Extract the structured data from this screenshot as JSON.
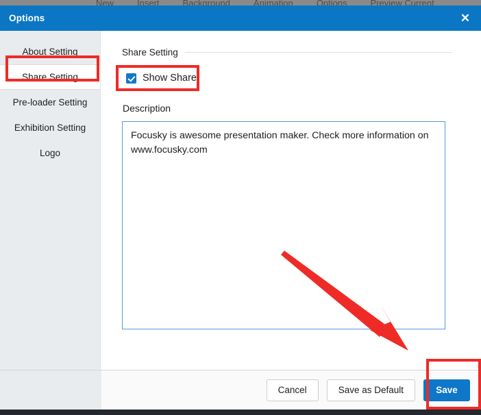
{
  "app": {
    "menu_items": [
      "New",
      "Insert",
      "Background",
      "Animation",
      "Options",
      "Preview Current"
    ]
  },
  "dialog": {
    "title": "Options",
    "close_label": "✕"
  },
  "sidebar": {
    "items": [
      {
        "label": "About Setting",
        "selected": false
      },
      {
        "label": "Share Setting",
        "selected": true
      },
      {
        "label": "Pre-loader Setting",
        "selected": false
      },
      {
        "label": "Exhibition Setting",
        "selected": false
      },
      {
        "label": "Logo",
        "selected": false
      }
    ]
  },
  "content": {
    "group_title": "Share Setting",
    "show_share": {
      "label": "Show Share",
      "checked": true
    },
    "description": {
      "label": "Description",
      "value": "Focusky is awesome presentation maker. Check more information on www.focusky.com"
    }
  },
  "footer": {
    "cancel_label": "Cancel",
    "save_as_default_label": "Save as Default",
    "save_label": "Save"
  },
  "colors": {
    "accent": "#0b76c4",
    "primary_button": "#0e77c8",
    "annotation": "#ee2b26",
    "sidebar_bg": "#e9ecef",
    "textarea_border": "#539ae0"
  }
}
